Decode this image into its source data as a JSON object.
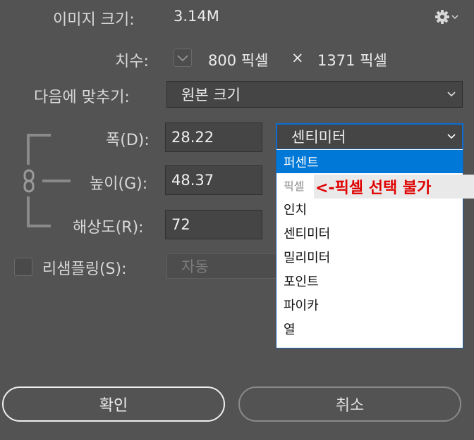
{
  "image_size": {
    "label": "이미지 크기:",
    "value": "3.14M"
  },
  "dimensions": {
    "label": "치수:",
    "width": "800 픽셀",
    "times": "×",
    "height": "1371 픽셀"
  },
  "fit_to": {
    "label": "다음에 맞추기:",
    "value": "원본 크기"
  },
  "width": {
    "label": "폭(D):",
    "value": "28.22",
    "unit": "센티미터"
  },
  "height": {
    "label": "높이(G):",
    "value": "48.37"
  },
  "resolution": {
    "label": "해상도(R):",
    "value": "72"
  },
  "resample": {
    "label": "리샘플링(S):",
    "value": "자동"
  },
  "unit_menu": {
    "items": [
      "퍼센트",
      "픽셀",
      "인치",
      "센티미터",
      "밀리미터",
      "포인트",
      "파이카",
      "열"
    ],
    "selected": "퍼센트",
    "disabled": "픽셀"
  },
  "annotation": "<-픽셀 선택 불가",
  "buttons": {
    "ok": "확인",
    "cancel": "취소"
  },
  "icons": [
    "gear-icon",
    "chevron-down-icon",
    "link-icon",
    "checkbox"
  ],
  "colors": {
    "background": "#535353",
    "field": "#454545",
    "menu_highlight": "#0078d7",
    "annotation_red": "#e00000"
  }
}
